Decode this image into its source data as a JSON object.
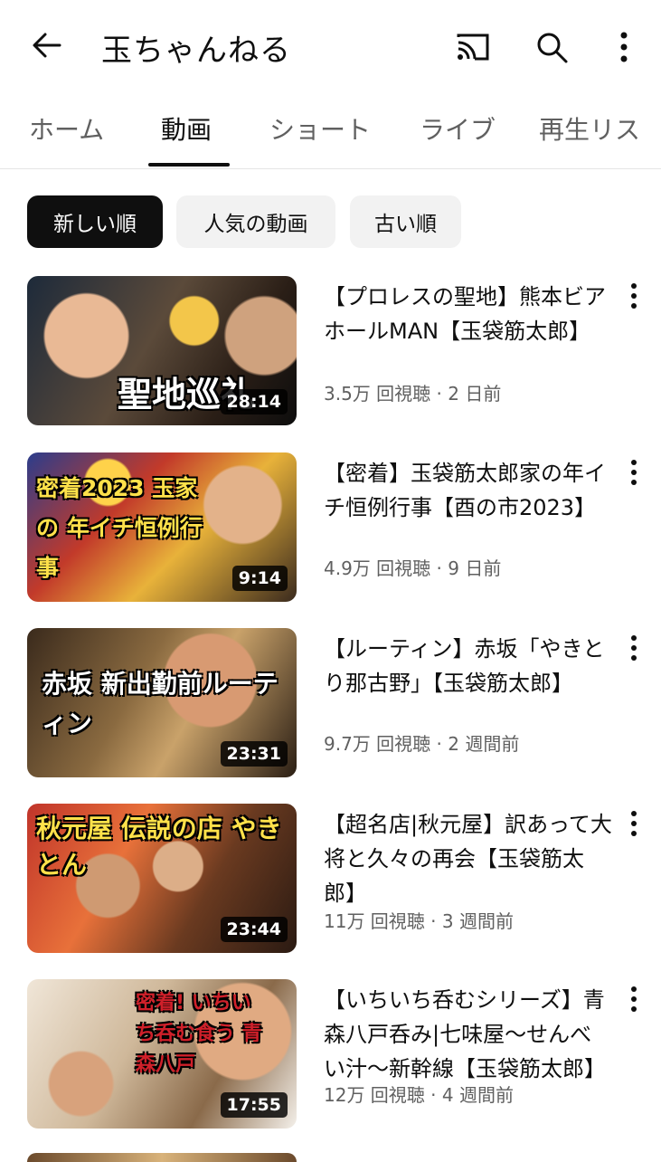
{
  "header": {
    "title": "玉ちゃんねる",
    "icons": {
      "back": "back-arrow-icon",
      "cast": "cast-icon",
      "search": "search-icon",
      "more": "more-vertical-icon"
    }
  },
  "tabs": [
    {
      "label": "ホーム",
      "active": false
    },
    {
      "label": "動画",
      "active": true
    },
    {
      "label": "ショート",
      "active": false
    },
    {
      "label": "ライブ",
      "active": false
    },
    {
      "label": "再生リス",
      "active": false
    }
  ],
  "chips": [
    {
      "label": "新しい順",
      "selected": true
    },
    {
      "label": "人気の動画",
      "selected": false
    },
    {
      "label": "古い順",
      "selected": false
    }
  ],
  "videos": [
    {
      "title": "【プロレスの聖地】熊本ビアホールMAN【玉袋筋太郎】",
      "meta": "3.5万 回視聴 · 2 日前",
      "duration": "28:14",
      "overlay": "聖地巡礼"
    },
    {
      "title": "【密着】玉袋筋太郎家の年イチ恒例行事【酉の市2023】",
      "meta": "4.9万 回視聴 · 9 日前",
      "duration": "9:14",
      "overlay": "密着2023 玉家の 年イチ恒例行事"
    },
    {
      "title": "【ルーティン】赤坂「やきとり那古野」【玉袋筋太郎】",
      "meta": "9.7万 回視聴 · 2 週間前",
      "duration": "23:31",
      "overlay": "赤坂 新出勤前ルーティン"
    },
    {
      "title": "【超名店|秋元屋】訳あって大将と久々の再会【玉袋筋太郎】",
      "meta": "11万 回視聴 · 3 週間前",
      "duration": "23:44",
      "overlay": "秋元屋 伝説の店 やきとん"
    },
    {
      "title": "【いちいち呑むシリーズ】青森八戸呑み|七味屋〜せんべい汁〜新幹線【玉袋筋太郎】",
      "meta": "12万 回視聴 · 4 週間前",
      "duration": "17:55",
      "overlay": "密着! いちいち呑む食う 青森八戸"
    }
  ],
  "colors": {
    "accent": "#0f0f0f",
    "secondary_text": "#606060",
    "chip_bg": "#f2f2f2"
  }
}
